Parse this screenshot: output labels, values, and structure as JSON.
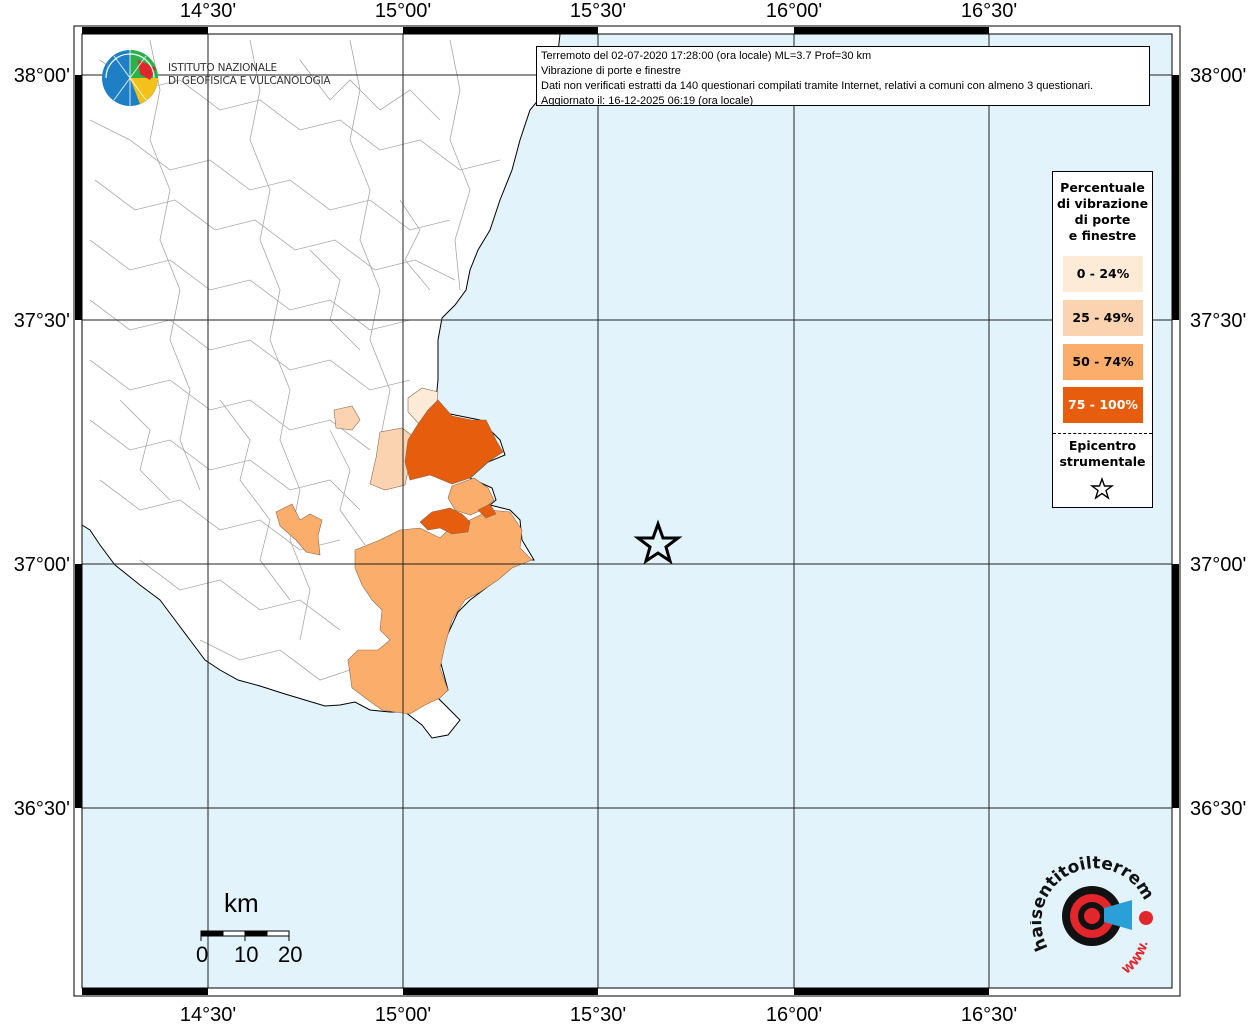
{
  "map": {
    "lon_ticks": [
      "14°30'",
      "15°00'",
      "15°30'",
      "16°00'",
      "16°30'"
    ],
    "lat_ticks": [
      "38°00'",
      "37°30'",
      "37°00'",
      "36°30'"
    ],
    "sea_color": "#e2f3fc",
    "land_color": "#ffffff"
  },
  "info": {
    "line1": "Terremoto del 02-07-2020 17:28:00 (ora locale) ML=3.7 Prof=30 km",
    "line2": "Vibrazione di porte e finestre",
    "line3": "Dati non verificati estratti da 140 questionari compilati tramite Internet, relativi a comuni con almeno 3 questionari.",
    "line4": "Aggiornato il: 16-12-2025 06:19 (ora locale)"
  },
  "legend": {
    "title_lines": [
      "Percentuale",
      "di vibrazione",
      "di porte",
      "e finestre"
    ],
    "classes": [
      {
        "label": "0 - 24%",
        "color": "#fdebd8",
        "text_color": "#000000"
      },
      {
        "label": "25 - 49%",
        "color": "#fcd3b0",
        "text_color": "#000000"
      },
      {
        "label": "50 - 74%",
        "color": "#fbae6b",
        "text_color": "#000000"
      },
      {
        "label": "75 - 100%",
        "color": "#e65d0d",
        "text_color": "#ffffff"
      }
    ],
    "epicenter_lines": [
      "Epicentro",
      "strumentale"
    ]
  },
  "logos": {
    "ingv_lines": [
      "ISTITUTO NAZIONALE",
      "DI GEOFISICA E VULCANOLOGIA"
    ],
    "hst_text": "haisentitoilterremoto.it",
    "hst_www": "WWW."
  },
  "scale": {
    "unit": "km",
    "labels": [
      "0",
      "10",
      "20"
    ]
  }
}
